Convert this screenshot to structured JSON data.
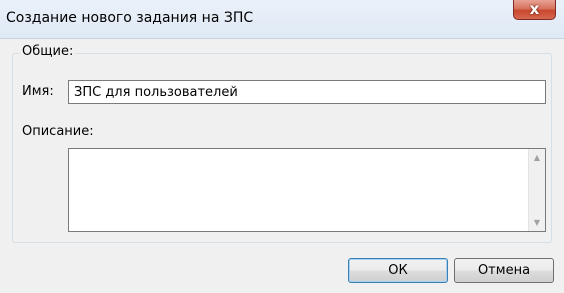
{
  "window": {
    "title": "Создание нового задания на ЗПС",
    "close_glyph": "x"
  },
  "general_group": {
    "legend": "Общие:",
    "name_label": "Имя:",
    "name_value": "ЗПС для пользователей",
    "description_label": "Описание:",
    "description_value": ""
  },
  "buttons": {
    "ok_label": "ОК",
    "cancel_label": "Отмена"
  },
  "icons": {
    "close": "close-icon",
    "scroll_up": "scroll-up-arrow-icon",
    "scroll_down": "scroll-down-arrow-icon"
  }
}
